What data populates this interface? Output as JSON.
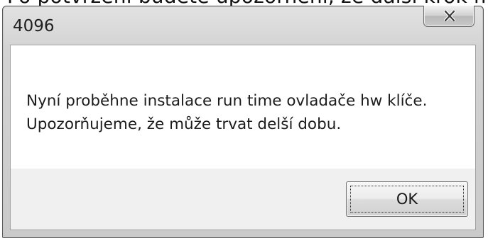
{
  "background": {
    "partial_text": "Po potvrzení budete upozorněni, že další krok mu"
  },
  "dialog": {
    "title": "4096",
    "close_icon": "close-x-icon",
    "message_line_1": "Nyní proběhne instalace run time ovladače hw klíče.",
    "message_line_2": "Upozorňujeme, že může trvat delší dobu.",
    "ok_label": "OK"
  }
}
